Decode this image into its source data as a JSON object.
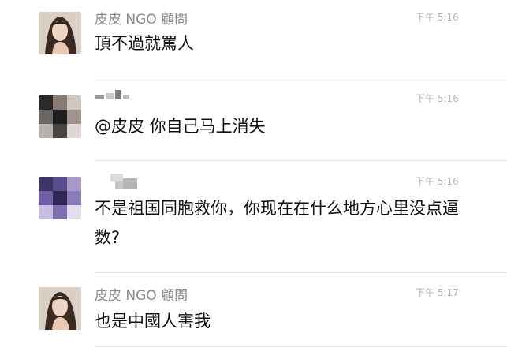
{
  "messages": [
    {
      "sender": "皮皮 NGO 顧問",
      "time": "下午 5:16",
      "text": "頂不過就罵人"
    },
    {
      "sender": "",
      "time": "下午 5:16",
      "text": "@皮皮 你自己马上消失"
    },
    {
      "sender": "",
      "time": "下午 5:16",
      "text": "不是祖国同胞救你，你现在在什么地方心里没点逼数?"
    },
    {
      "sender": "皮皮 NGO 顧問",
      "time": "下午 5:17",
      "text": "也是中國人害我"
    }
  ],
  "colors": {
    "name_gray": "#8a8a8a",
    "time_gray": "#b3b3b3",
    "divider": "#e6e6e6"
  },
  "icons": {
    "avatar_1": "woman-portrait-avatar",
    "avatar_2": "pixelated-avatar",
    "avatar_3": "pixelated-purple-avatar",
    "avatar_4": "woman-portrait-avatar"
  }
}
